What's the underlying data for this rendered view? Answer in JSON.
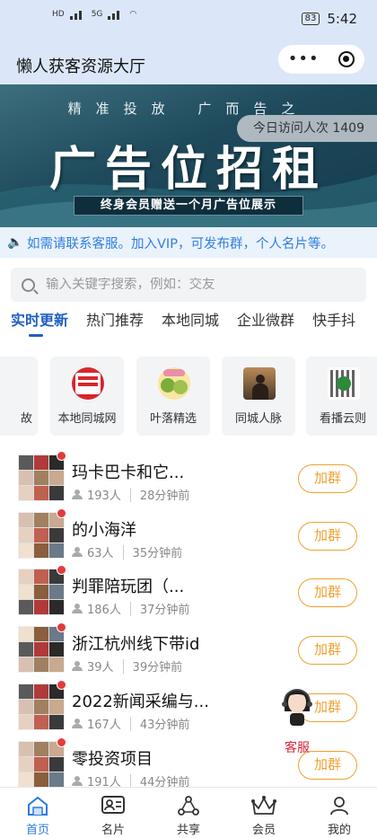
{
  "status_bar": {
    "left_labels": [
      "HD",
      "4G",
      "5G"
    ],
    "battery": "83",
    "time": "5:42"
  },
  "header": {
    "title": "懒人获客资源大厅"
  },
  "banner": {
    "line1": "精准投放 广而告之",
    "headline": "广告位招租",
    "subline": "终身会员赠送一个月广告位展示",
    "visits": "今日访问人次 1409"
  },
  "notice": {
    "text": "如需请联系客服。加入VIP，可发布群，个人名片等。"
  },
  "search": {
    "placeholder": "输入关键字搜索，例如：交友"
  },
  "tabs": [
    "实时更新",
    "热门推荐",
    "本地同城",
    "企业微群",
    "快手抖"
  ],
  "categories": [
    {
      "label": "故",
      "icon": "partial-icon"
    },
    {
      "label": "本地同城网",
      "icon": "local-city-icon"
    },
    {
      "label": "叶落精选",
      "icon": "fruit-icon"
    },
    {
      "label": "同城人脉",
      "icon": "people-icon"
    },
    {
      "label": "看播云则",
      "icon": "qr-icon"
    }
  ],
  "groups": [
    {
      "name": "玛卡巴卡和它...",
      "members": "193人",
      "time": "28分钟前",
      "button": "加群"
    },
    {
      "name": "的小海洋",
      "members": "63人",
      "time": "35分钟前",
      "button": "加群"
    },
    {
      "name": "判罪陪玩团（...",
      "members": "186人",
      "time": "37分钟前",
      "button": "加群"
    },
    {
      "name": "浙江杭州线下带id",
      "members": "39人",
      "time": "39分钟前",
      "button": "加群"
    },
    {
      "name": "2022新闻采编与...",
      "members": "167人",
      "time": "43分钟前",
      "button": "加群"
    },
    {
      "name": "零投资项目",
      "members": "191人",
      "time": "44分钟前",
      "button": "加群"
    }
  ],
  "customer_service": {
    "label": "客服"
  },
  "bottom_nav": [
    {
      "label": "首页",
      "icon": "home-icon"
    },
    {
      "label": "名片",
      "icon": "card-icon"
    },
    {
      "label": "共享",
      "icon": "share-icon"
    },
    {
      "label": "会员",
      "icon": "crown-icon"
    },
    {
      "label": "我的",
      "icon": "user-icon"
    }
  ],
  "colors": {
    "accent_blue": "#1f5fc0",
    "notice_blue": "#2f7fe0",
    "join_orange": "#f0a030",
    "badge_red": "#e23b3b"
  }
}
